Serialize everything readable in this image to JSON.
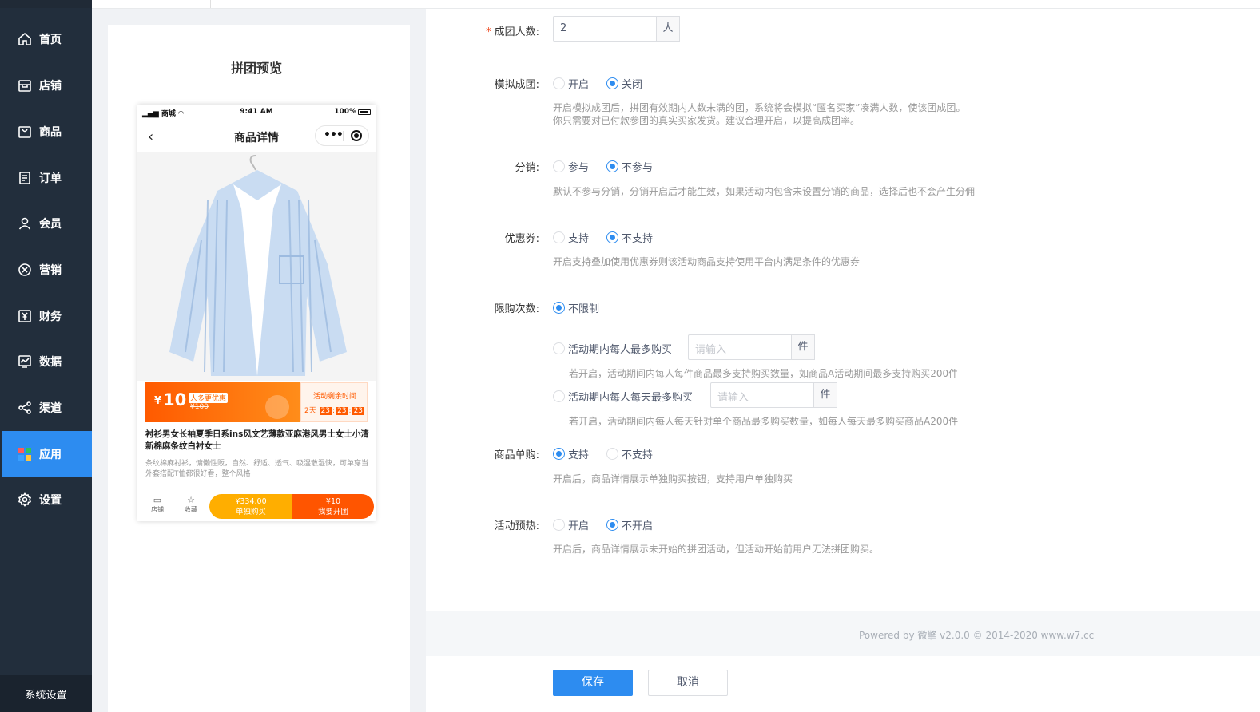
{
  "sidebar": {
    "items": [
      {
        "label": "首页",
        "icon": "home-icon",
        "active": false
      },
      {
        "label": "店铺",
        "icon": "shop-icon",
        "active": false
      },
      {
        "label": "商品",
        "icon": "bag-icon",
        "active": false
      },
      {
        "label": "订单",
        "icon": "order-icon",
        "active": false
      },
      {
        "label": "会员",
        "icon": "user-icon",
        "active": false
      },
      {
        "label": "营销",
        "icon": "marketing-icon",
        "active": false
      },
      {
        "label": "财务",
        "icon": "finance-icon",
        "active": false
      },
      {
        "label": "数据",
        "icon": "chart-icon",
        "active": false
      },
      {
        "label": "渠道",
        "icon": "share-icon",
        "active": false
      },
      {
        "label": "应用",
        "icon": "apps-icon",
        "active": true
      },
      {
        "label": "设置",
        "icon": "gear-icon",
        "active": false
      }
    ],
    "system_settings": "系统设置",
    "colors": {
      "bg": "#222e3c",
      "active": "#2d8cf0"
    }
  },
  "preview": {
    "title": "拼团预览",
    "status_bar": {
      "carrier": "商城",
      "time": "9:41 AM",
      "battery": "100%"
    },
    "nav_title": "商品详情",
    "price": {
      "symbol": "¥",
      "amount": "10",
      "tag": "人多更优惠",
      "original": "¥100",
      "countdown_title": "活动剩余时间",
      "countdown_days": "2天",
      "countdown_h": "23",
      "countdown_m": "23",
      "countdown_s": "23"
    },
    "product_title": "衬衫男女长袖夏季日系ins风文艺薄款亚麻港风男士女士小清新棉麻条纹白衬女士",
    "product_desc": "条纹棉麻衬衫，慵懒性贩，自然、舒适、透气、吸湿散湿快，可单穿当外套搭配T恤都很好看，整个风格",
    "bottom": {
      "shop_label": "店铺",
      "fav_label": "收藏",
      "solo_price": "¥334.00",
      "solo_label": "单独购买",
      "group_price": "¥10",
      "group_label": "我要开团"
    }
  },
  "form": {
    "group_size": {
      "label": "成团人数:",
      "value": "2",
      "suffix": "人"
    },
    "simulate": {
      "label": "模拟成团:",
      "options": [
        "开启",
        "关闭"
      ],
      "selected": "关闭",
      "hint1": "开启模拟成团后，拼团有效期内人数未满的团，系统将会模拟“匿名买家”凑满人数，使该团成团。",
      "hint2": "你只需要对已付款参团的真实买家发货。建议合理开启，以提高成团率。"
    },
    "distribution": {
      "label": "分销:",
      "options": [
        "参与",
        "不参与"
      ],
      "selected": "不参与",
      "hint": "默认不参与分销，分销开启后才能生效，如果活动内包含未设置分销的商品，选择后也不会产生分佣"
    },
    "coupon": {
      "label": "优惠券:",
      "options": [
        "支持",
        "不支持"
      ],
      "selected": "不支持",
      "hint": "开启支持叠加使用优惠券则该活动商品支持使用平台内满足条件的优惠券"
    },
    "limit": {
      "label": "限购次数:",
      "opt_none": "不限制",
      "opt_per_activity": "活动期内每人最多购买",
      "opt_per_day": "活动期内每人每天最多购买",
      "placeholder": "请输入",
      "unit": "件",
      "hint_activity": "若开启，活动期间内每人每件商品最多支持购买数量，如商品A活动期间最多支持购买200件",
      "hint_day": "若开启，活动期间内每人每天针对单个商品最多购买数量，如每人每天最多购买商品A200件",
      "selected": "不限制"
    },
    "single_buy": {
      "label": "商品单购:",
      "options": [
        "支持",
        "不支持"
      ],
      "selected": "支持",
      "hint": "开启后，商品详情展示单独购买按钮，支持用户单独购买"
    },
    "preheat": {
      "label": "活动预热:",
      "options": [
        "开启",
        "不开启"
      ],
      "selected": "不开启",
      "hint": "开启后，商品详情展示未开始的拼团活动，但活动开始前用户无法拼团购买。"
    }
  },
  "footer": {
    "powered": "Powered by 微擎 v2.0.0 © 2014-2020 www.w7.cc",
    "save": "保存",
    "cancel": "取消"
  }
}
